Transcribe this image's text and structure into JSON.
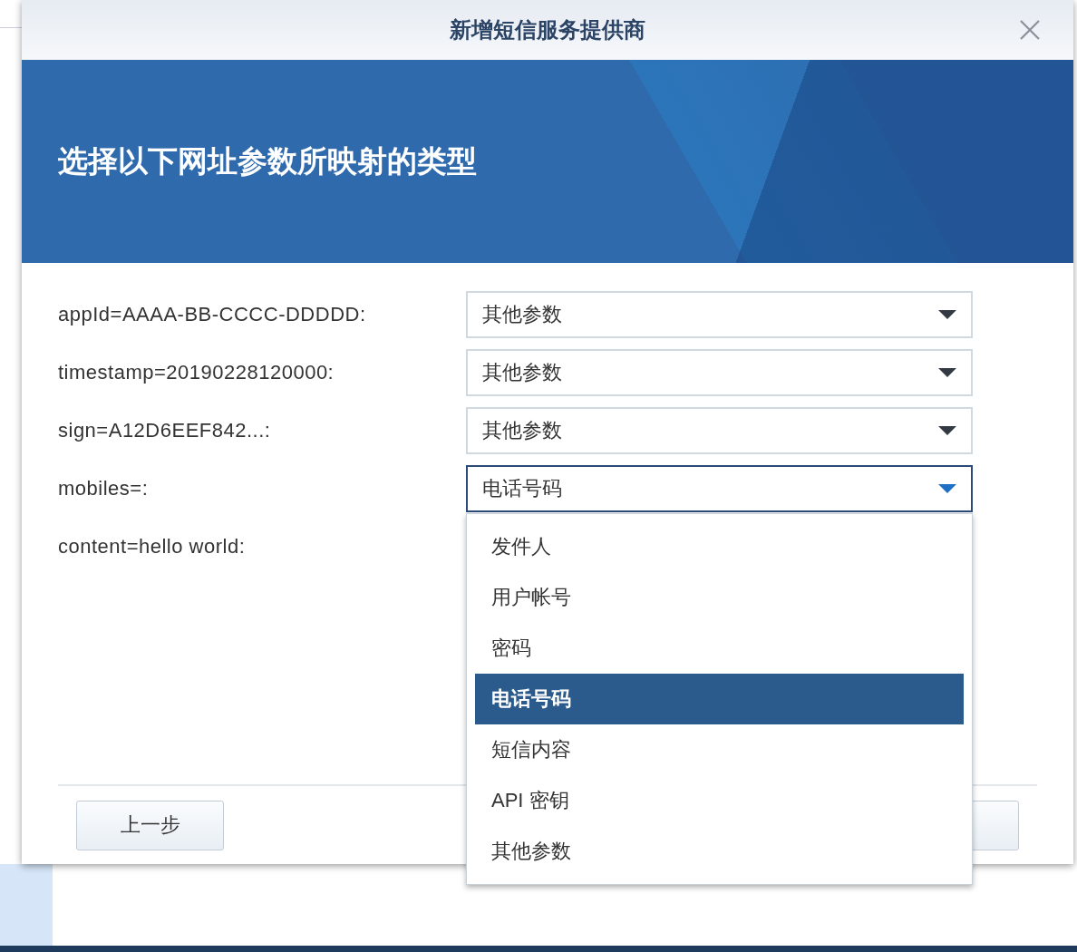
{
  "dialog": {
    "title": "新增短信服务提供商",
    "banner_heading": "选择以下网址参数所映射的类型",
    "params": [
      {
        "label": "appId=AAAA-BB-CCCC-DDDDD:",
        "value": "其他参数",
        "open": false
      },
      {
        "label": "timestamp=20190228120000:",
        "value": "其他参数",
        "open": false
      },
      {
        "label": "sign=A12D6EEF842...:",
        "value": "其他参数",
        "open": false
      },
      {
        "label": "mobiles=:",
        "value": "电话号码",
        "open": true
      },
      {
        "label": "content=hello world:"
      }
    ],
    "dropdown_options": [
      {
        "label": "发件人",
        "selected": false
      },
      {
        "label": "用户帐号",
        "selected": false
      },
      {
        "label": "密码",
        "selected": false
      },
      {
        "label": "电话号码",
        "selected": true
      },
      {
        "label": "短信内容",
        "selected": false
      },
      {
        "label": "API 密钥",
        "selected": false
      },
      {
        "label": "其他参数",
        "selected": false
      }
    ],
    "back_button": "上一步"
  }
}
